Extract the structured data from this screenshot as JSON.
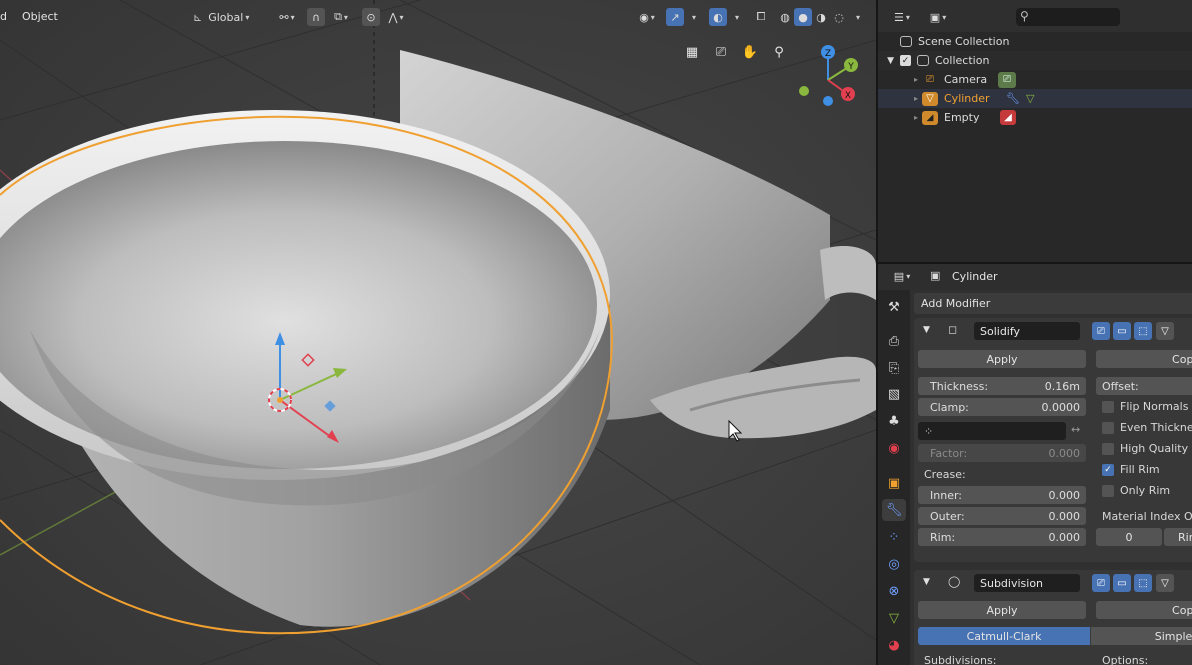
{
  "viewport": {
    "menu": {
      "partial_left": "d",
      "object": "Object"
    },
    "orientation": "Global"
  },
  "outliner": {
    "scene_collection": "Scene Collection",
    "collection": "Collection",
    "items": [
      {
        "label": "Camera",
        "icon": "camera-icon",
        "data_icon": "camera-data-icon"
      },
      {
        "label": "Cylinder",
        "icon": "mesh-icon",
        "data_icon": "modifier-wrench-icon",
        "selected": true
      },
      {
        "label": "Empty",
        "icon": "empty-icon",
        "data_icon": "image-icon"
      }
    ]
  },
  "properties": {
    "object_name": "Cylinder",
    "add_modifier": "Add Modifier",
    "solidify": {
      "name": "Solidify",
      "apply": "Apply",
      "copy": "Copy",
      "thickness_label": "Thickness:",
      "thickness_value": "0.16m",
      "clamp_label": "Clamp:",
      "clamp_value": "0.0000",
      "offset_label": "Offset:",
      "flip_normals": "Flip Normals",
      "even_thickness": "Even Thickness",
      "high_quality": "High Quality No",
      "fill_rim": "Fill Rim",
      "only_rim": "Only Rim",
      "factor_label": "Factor:",
      "factor_value": "0.000",
      "crease": "Crease:",
      "inner_label": "Inner:",
      "inner_value": "0.000",
      "outer_label": "Outer:",
      "outer_value": "0.000",
      "rim_label": "Rim:",
      "rim_value": "0.000",
      "material_index": "Material Index Offs",
      "material_value": "0",
      "rim_right": "Rim"
    },
    "subdivision": {
      "name": "Subdivision",
      "apply": "Apply",
      "copy": "Copy",
      "catmull": "Catmull-Clark",
      "simple": "Simple",
      "subdivisions": "Subdivisions:",
      "options": "Options:"
    }
  },
  "colors": {
    "accent": "#4772b3",
    "selection_outline": "#f0a030",
    "axis_x": "#e2404f",
    "axis_y": "#8ab83e",
    "axis_z": "#3f8fe5"
  }
}
